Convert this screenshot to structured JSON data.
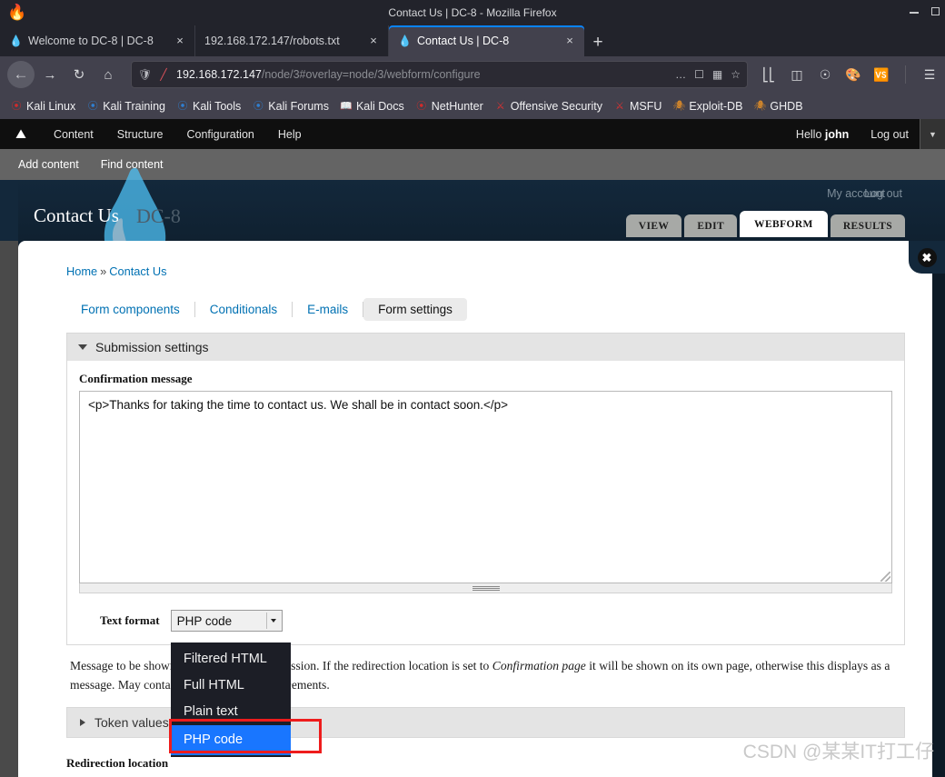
{
  "browser": {
    "window_title": "Contact Us | DC-8 - Mozilla Firefox",
    "firefox_icon": "firefox-logo-icon",
    "window_controls": {
      "minimize": "minimize-icon",
      "maximize": "maximize-icon"
    },
    "tabs": [
      {
        "title": "Welcome to DC-8 | DC-8",
        "favicon": "drupal-favicon",
        "active": false,
        "close": "×"
      },
      {
        "title": "192.168.172.147/robots.txt",
        "favicon": "blank-favicon",
        "active": false,
        "close": "×"
      },
      {
        "title": "Contact Us | DC-8",
        "favicon": "drupal-favicon",
        "active": true,
        "close": "×"
      }
    ],
    "new_tab_label": "+",
    "nav": {
      "back": "←",
      "forward": "→",
      "reload": "↻",
      "home": "⌂"
    },
    "url": {
      "host": "192.168.172.147",
      "path": "/node/3#overlay=node/3/webform/configure",
      "shield_icon": "shield-icon",
      "nosecure_icon": "no-https-icon",
      "ellipsis": "…",
      "reader_icon": "reader-mode-icon",
      "translate_icon": "translate-icon",
      "star_icon": "bookmark-star-icon"
    },
    "chrome_icons": [
      "library-icon",
      "sidebar-icon",
      "account-icon",
      "theme-icon",
      "translate-addon-icon",
      "menu-icon"
    ],
    "bookmarks": [
      {
        "label": "Kali Linux",
        "icon": "kali-dragon-icon"
      },
      {
        "label": "Kali Training",
        "icon": "kali-dragon-icon"
      },
      {
        "label": "Kali Tools",
        "icon": "kali-dragon-icon"
      },
      {
        "label": "Kali Forums",
        "icon": "kali-dragon-icon"
      },
      {
        "label": "Kali Docs",
        "icon": "kali-docs-icon"
      },
      {
        "label": "NetHunter",
        "icon": "nethunter-icon"
      },
      {
        "label": "Offensive Security",
        "icon": "offsec-icon"
      },
      {
        "label": "MSFU",
        "icon": "offsec-icon"
      },
      {
        "label": "Exploit-DB",
        "icon": "exploitdb-spider-icon"
      },
      {
        "label": "GHDB",
        "icon": "exploitdb-spider-icon"
      }
    ]
  },
  "admin_toolbar": {
    "home_icon": "drupal-home-icon",
    "links": [
      "Content",
      "Structure",
      "Configuration",
      "Help"
    ],
    "greeting_prefix": "Hello ",
    "username": "john",
    "logout": "Log out",
    "drawer_toggle": "▼",
    "shortcuts": [
      "Add content",
      "Find content"
    ]
  },
  "site": {
    "my_account": "My account",
    "log_out": "Log out",
    "title": "Contact Us",
    "slogan": "DC-8",
    "node_tabs": [
      {
        "label": "VIEW",
        "selected": false
      },
      {
        "label": "EDIT",
        "selected": false
      },
      {
        "label": "WEBFORM",
        "selected": true
      },
      {
        "label": "RESULTS",
        "selected": false
      }
    ]
  },
  "overlay": {
    "close_icon": "close-overlay-icon",
    "breadcrumb": {
      "home": "Home",
      "separator": "»",
      "current": "Contact Us"
    },
    "subtabs": [
      {
        "label": "Form components",
        "active": false
      },
      {
        "label": "Conditionals",
        "active": false
      },
      {
        "label": "E-mails",
        "active": false
      },
      {
        "label": "Form settings",
        "active": true
      }
    ],
    "fieldset": {
      "legend": "Submission settings",
      "confirmation_label": "Confirmation message",
      "confirmation_value": "<p>Thanks for taking the time to contact us. We shall be in contact soon.</p>",
      "text_format_label": "Text format",
      "text_format_value": "PHP code",
      "text_format_options": [
        "Filtered HTML",
        "Full HTML",
        "Plain text",
        "PHP code"
      ],
      "description_part1": "Message to be shown upon successful submission. If the redirection location is set to ",
      "description_em": "Confirmation page",
      "description_part2": " it will be shown on its own page, otherwise this displays as a message. May contain webform token replacements."
    },
    "token_values_legend": "Token values",
    "redirection_label": "Redirection location"
  },
  "watermark": "CSDN @某某IT打工仔"
}
